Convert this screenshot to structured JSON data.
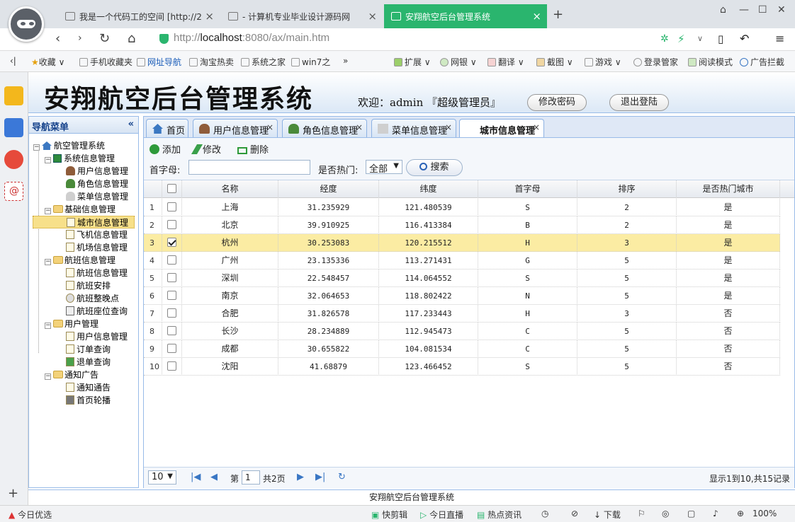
{
  "browser": {
    "tabs": [
      {
        "title": "我是一个代码工的空间 [http://2"
      },
      {
        "title": "- 计算机专业毕业设计源码网"
      },
      {
        "title": "安翔航空后台管理系统"
      }
    ],
    "url_host": "localhost",
    "url_rest": ":8080/ax/main.htm",
    "bookmarks": [
      "收藏",
      "手机收藏夹",
      "网址导航",
      "淘宝热卖",
      "系统之家",
      "win7之"
    ],
    "right_tools": [
      "扩展",
      "网银",
      "翻译",
      "截图",
      "游戏",
      "登录管家",
      "阅读模式",
      "广告拦截"
    ],
    "status": {
      "left": "今日优选",
      "items": [
        "快剪辑",
        "今日直播",
        "热点资讯",
        "下载"
      ],
      "zoom": "100%"
    }
  },
  "app": {
    "title": "安翔航空后台管理系统",
    "welcome": "欢迎：admin 『超级管理员』",
    "change_password": "修改密码",
    "logout": "退出登陆",
    "footer": "安翔航空后台管理系统"
  },
  "nav": {
    "title": "导航菜单",
    "root": "航空管理系统",
    "groups": [
      {
        "label": "系统信息管理",
        "items": [
          "用户信息管理",
          "角色信息管理",
          "菜单信息管理"
        ]
      },
      {
        "label": "基础信息管理",
        "items": [
          "城市信息管理",
          "飞机信息管理",
          "机场信息管理"
        ]
      },
      {
        "label": "航班信息管理",
        "items": [
          "航班信息管理",
          "航班安排",
          "航班整晚点",
          "航班座位查询"
        ]
      },
      {
        "label": "用户管理",
        "items": [
          "用户信息管理",
          "订单查询",
          "退单查询"
        ]
      },
      {
        "label": "通知广告",
        "items": [
          "通知通告",
          "首页轮播"
        ]
      }
    ]
  },
  "tabs": [
    "首页",
    "用户信息管理",
    "角色信息管理",
    "菜单信息管理",
    "城市信息管理"
  ],
  "toolbar": {
    "add": "添加",
    "edit": "修改",
    "delete": "删除"
  },
  "search": {
    "first_letter_label": "首字母:",
    "first_letter_value": "",
    "hot_label": "是否热门:",
    "hot_value": "全部",
    "button": "搜索"
  },
  "grid": {
    "headers": [
      "名称",
      "经度",
      "纬度",
      "首字母",
      "排序",
      "是否热门城市"
    ],
    "rows": [
      {
        "n": "1",
        "name": "上海",
        "lng": "31.235929",
        "lat": "121.480539",
        "letter": "S",
        "order": "2",
        "hot": "是",
        "checked": false
      },
      {
        "n": "2",
        "name": "北京",
        "lng": "39.910925",
        "lat": "116.413384",
        "letter": "B",
        "order": "2",
        "hot": "是",
        "checked": false
      },
      {
        "n": "3",
        "name": "杭州",
        "lng": "30.253083",
        "lat": "120.215512",
        "letter": "H",
        "order": "3",
        "hot": "是",
        "checked": true
      },
      {
        "n": "4",
        "name": "广州",
        "lng": "23.135336",
        "lat": "113.271431",
        "letter": "G",
        "order": "5",
        "hot": "是",
        "checked": false
      },
      {
        "n": "5",
        "name": "深圳",
        "lng": "22.548457",
        "lat": "114.064552",
        "letter": "S",
        "order": "5",
        "hot": "是",
        "checked": false
      },
      {
        "n": "6",
        "name": "南京",
        "lng": "32.064653",
        "lat": "118.802422",
        "letter": "N",
        "order": "5",
        "hot": "是",
        "checked": false
      },
      {
        "n": "7",
        "name": "合肥",
        "lng": "31.826578",
        "lat": "117.233443",
        "letter": "H",
        "order": "3",
        "hot": "否",
        "checked": false
      },
      {
        "n": "8",
        "name": "长沙",
        "lng": "28.234889",
        "lat": "112.945473",
        "letter": "C",
        "order": "5",
        "hot": "否",
        "checked": false
      },
      {
        "n": "9",
        "name": "成都",
        "lng": "30.655822",
        "lat": "104.081534",
        "letter": "C",
        "order": "5",
        "hot": "否",
        "checked": false
      },
      {
        "n": "10",
        "name": "沈阳",
        "lng": "41.68879",
        "lat": "123.466452",
        "letter": "S",
        "order": "5",
        "hot": "否",
        "checked": false
      }
    ]
  },
  "pager": {
    "page_size": "10",
    "page_prefix": "第",
    "page": "1",
    "page_total": "共2页",
    "info": "显示1到10,共15记录"
  }
}
